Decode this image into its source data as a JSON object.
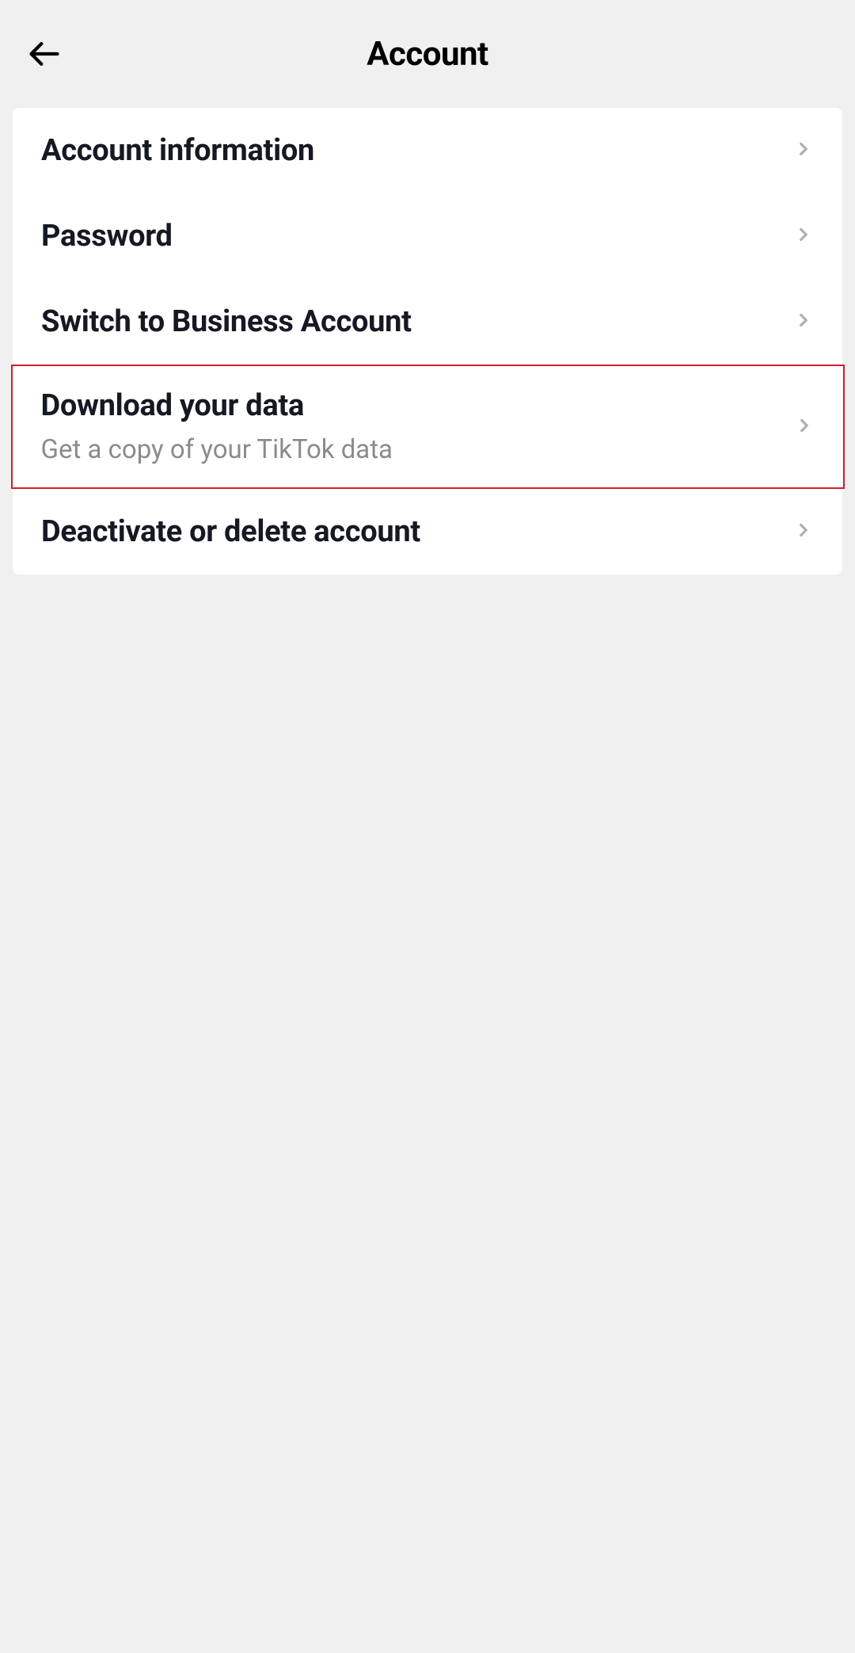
{
  "header": {
    "title": "Account"
  },
  "items": [
    {
      "label": "Account information",
      "sub": null,
      "highlight": false
    },
    {
      "label": "Password",
      "sub": null,
      "highlight": false
    },
    {
      "label": "Switch to Business Account",
      "sub": null,
      "highlight": false
    },
    {
      "label": "Download your data",
      "sub": "Get a copy of your TikTok data",
      "highlight": true
    },
    {
      "label": "Deactivate or delete account",
      "sub": null,
      "highlight": false
    }
  ]
}
